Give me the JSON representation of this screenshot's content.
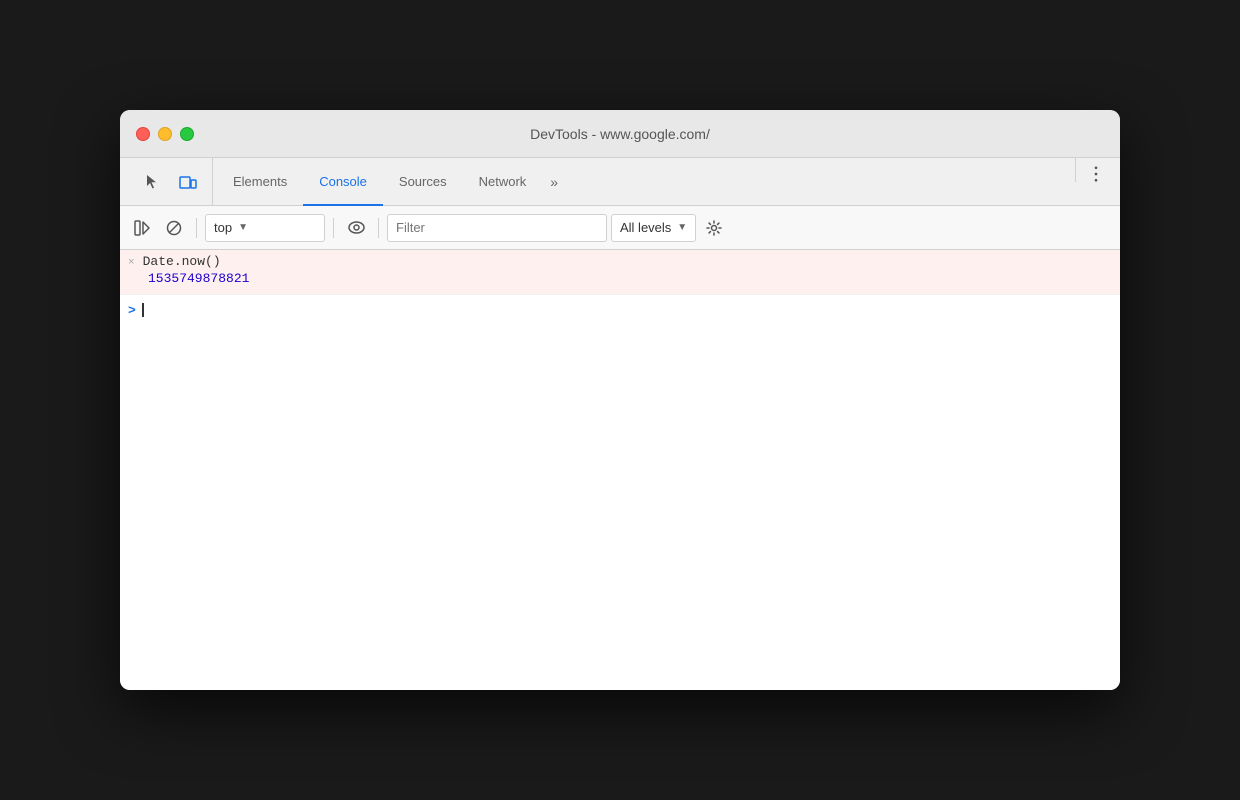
{
  "window": {
    "title": "DevTools - www.google.com/"
  },
  "traffic_lights": {
    "red_label": "close",
    "yellow_label": "minimize",
    "green_label": "maximize"
  },
  "tabs": [
    {
      "id": "elements",
      "label": "Elements",
      "active": false
    },
    {
      "id": "console",
      "label": "Console",
      "active": true
    },
    {
      "id": "sources",
      "label": "Sources",
      "active": false
    },
    {
      "id": "network",
      "label": "Network",
      "active": false
    }
  ],
  "toolbar": {
    "context_value": "top",
    "filter_placeholder": "Filter",
    "levels_label": "All levels",
    "more_label": "»"
  },
  "console": {
    "entry": {
      "icon": "×",
      "command": "Date.now()",
      "result": "1535749878821"
    },
    "prompt_icon": ">"
  }
}
